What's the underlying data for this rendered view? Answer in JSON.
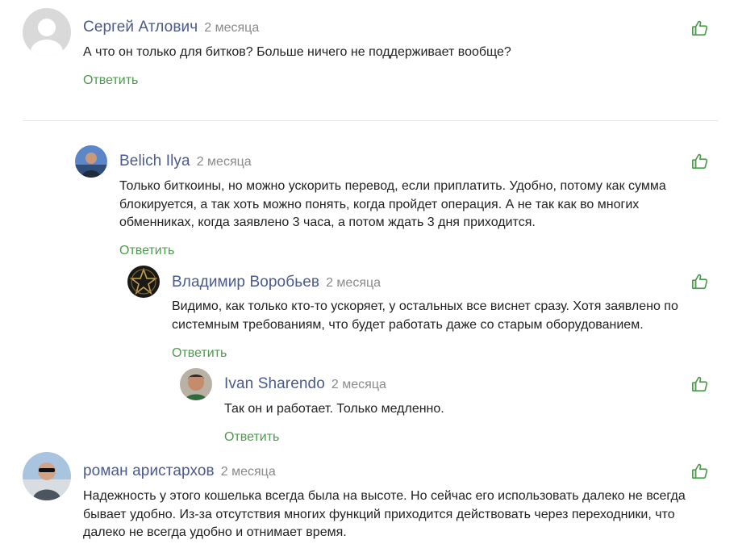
{
  "comments": [
    {
      "author": "Сергей Атлович",
      "date": "2 месяца",
      "text": "А что он только для битков? Больше ничего не поддерживает вообще?",
      "reply_label": "Ответить",
      "avatar_icon": "default-user-avatar"
    },
    {
      "author": "Belich Ilya",
      "date": "2 месяца",
      "text": "Только биткоины, но можно ускорить перевод, если приплатить. Удобно, потому как сумма блокируется, а так хоть можно понять, когда пройдет операция. А не так как во многих обменниках, когда заявлено 3 часа, а потом ждать 3 дня приходится.",
      "reply_label": "Ответить",
      "avatar_icon": "user-photo"
    },
    {
      "author": "Владимир Воробьев",
      "date": "2 месяца",
      "text": "Видимо, как только кто-то ускоряет, у остальных все виснет сразу. Хотя заявлено по системным требованиям, что будет работать даже со старым оборудованием.",
      "reply_label": "Ответить",
      "avatar_icon": "star-emblem"
    },
    {
      "author": "Ivan Sharendo",
      "date": "2 месяца",
      "text": "Так он и работает. Только медленно.",
      "reply_label": "Ответить",
      "avatar_icon": "user-photo"
    },
    {
      "author": "роман аристархов",
      "date": "2 месяца",
      "text": "Надежность у этого кошелька всегда была на высоте. Но сейчас его использовать далеко не всегда бывает удобно. Из-за отсутствия многих функций приходится действовать через переходники, что далеко не всегда удобно и отнимает время.",
      "avatar_icon": "user-photo"
    }
  ],
  "colors": {
    "author": "#4a5a8c",
    "date": "#8a8a8a",
    "reply": "#4c9a4c",
    "like": "#4c9a4c"
  },
  "like_icon": "thumbs-up-icon"
}
